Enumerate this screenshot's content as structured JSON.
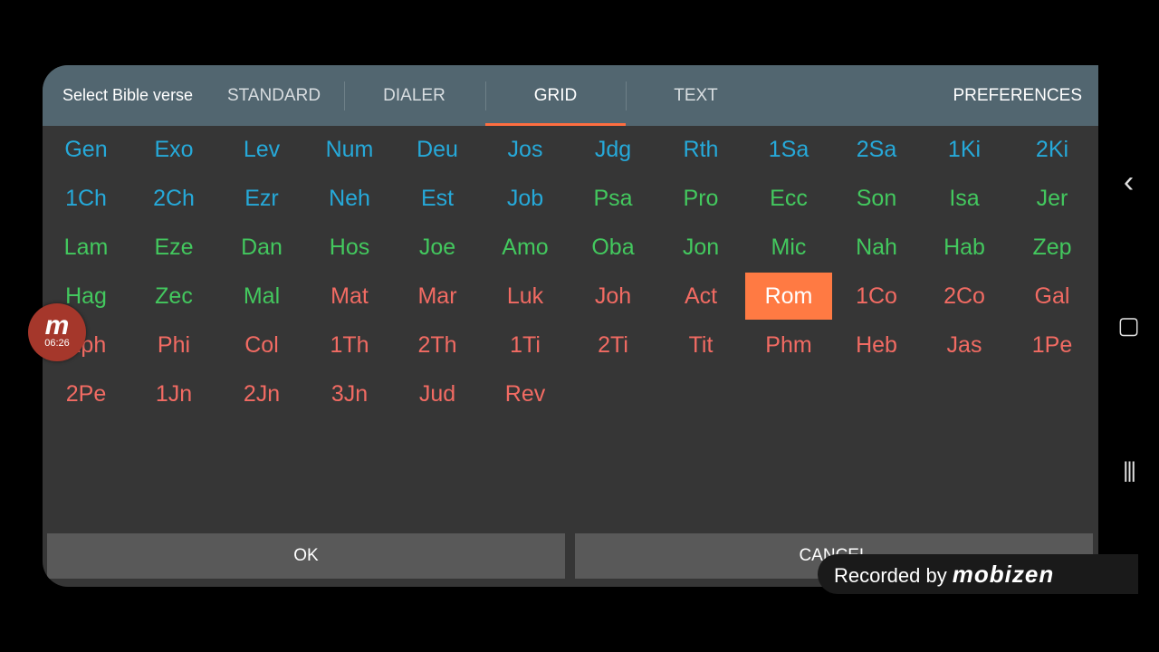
{
  "header": {
    "title": "Select Bible verse",
    "tabs": [
      {
        "label": "STANDARD"
      },
      {
        "label": "DIALER"
      },
      {
        "label": "GRID"
      },
      {
        "label": "TEXT"
      }
    ],
    "active_tab": "GRID",
    "preferences_label": "PREFERENCES"
  },
  "books": [
    "Gen",
    "Exo",
    "Lev",
    "Num",
    "Deu",
    "Jos",
    "Jdg",
    "Rth",
    "1Sa",
    "2Sa",
    "1Ki",
    "2Ki",
    "1Ch",
    "2Ch",
    "Ezr",
    "Neh",
    "Est",
    "Job",
    "Psa",
    "Pro",
    "Ecc",
    "Son",
    "Isa",
    "Jer",
    "Lam",
    "Eze",
    "Dan",
    "Hos",
    "Joe",
    "Amo",
    "Oba",
    "Jon",
    "Mic",
    "Nah",
    "Hab",
    "Zep",
    "Hag",
    "Zec",
    "Mal",
    "Mat",
    "Mar",
    "Luk",
    "Joh",
    "Act",
    "Rom",
    "1Co",
    "2Co",
    "Gal",
    "Eph",
    "Phi",
    "Col",
    "1Th",
    "2Th",
    "1Ti",
    "2Ti",
    "Tit",
    "Phm",
    "Heb",
    "Jas",
    "1Pe",
    "2Pe",
    "1Jn",
    "2Jn",
    "3Jn",
    "Jud",
    "Rev"
  ],
  "selected_book": "Rom",
  "colors": {
    "history_books": "#26a9d9",
    "poetry_prophets": "#43c85e",
    "new_testament": "#f26b63",
    "selected_bg": "#ff7a43",
    "header_bg": "#526670"
  },
  "buttons": {
    "ok": "OK",
    "cancel": "CANCEL"
  },
  "overlay": {
    "bubble_time": "06:26",
    "bubble_letter": "m",
    "recorded_text": "Recorded by",
    "recorded_brand": "mobizen"
  },
  "navbar": {
    "back_glyph": "‹",
    "home_glyph": "▢",
    "recents_glyph": "|||"
  }
}
